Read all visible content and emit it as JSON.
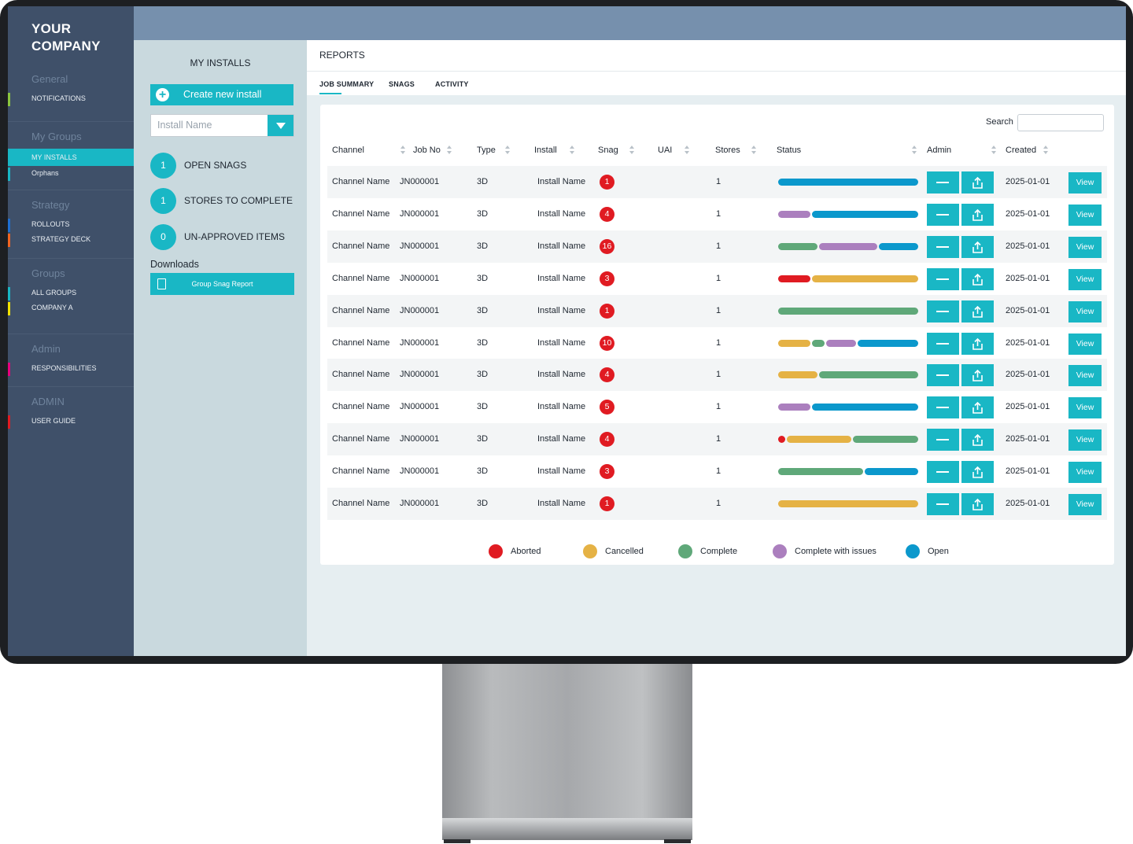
{
  "brand": "YOUR\nCOMPANY",
  "sidebar": {
    "sections": [
      {
        "head": "General",
        "items": [
          {
            "label": "NOTIFICATIONS",
            "color": "#8cc63f"
          }
        ]
      },
      {
        "head": "My Groups",
        "items": [
          {
            "label": "MY INSTALLS",
            "color": "#19b7c5",
            "active": true
          },
          {
            "label": "Orphans",
            "color": "#19b7c5"
          }
        ]
      },
      {
        "head": "Strategy",
        "items": [
          {
            "label": "ROLLOUTS",
            "color": "#1f6fd1"
          },
          {
            "label": "STRATEGY DECK",
            "color": "#f26522"
          }
        ]
      },
      {
        "head": "Groups",
        "items": [
          {
            "label": "ALL GROUPS",
            "color": "#19b7c5"
          },
          {
            "label": "COMPANY A",
            "color": "#f2e200"
          }
        ]
      },
      {
        "head": "Admin",
        "items": [
          {
            "label": "RESPONSIBILITIES",
            "color": "#e6007e"
          }
        ]
      },
      {
        "head": "ADMIN",
        "items": [
          {
            "label": "USER GUIDE",
            "color": "#e01b22"
          }
        ]
      }
    ]
  },
  "panel": {
    "title": "MY INSTALLS",
    "create_label": "Create new install",
    "install_placeholder": "Install Name",
    "stats": [
      {
        "count": "1",
        "label": "OPEN SNAGS"
      },
      {
        "count": "1",
        "label": "STORES TO COMPLETE"
      },
      {
        "count": "0",
        "label": "UN-APPROVED ITEMS"
      }
    ],
    "downloads_label": "Downloads",
    "download_button": "Group Snag Report"
  },
  "main": {
    "title": "REPORTS",
    "tabs": [
      "JOB SUMMARY",
      "SNAGS",
      "ACTIVITY"
    ],
    "search_label": "Search"
  },
  "table": {
    "columns": [
      "Channel",
      "Job No",
      "Type",
      "Install",
      "Snag",
      "UAI",
      "Stores",
      "Status",
      "Admin",
      "Created"
    ],
    "view_label": "View",
    "rows": [
      {
        "channel": "Channel Name",
        "job": "JN000001",
        "type": "3D",
        "install": "Install Name",
        "snag": "1",
        "uai": "",
        "stores": "1",
        "created": "2025-01-01",
        "status": [
          [
            "open",
            1
          ]
        ]
      },
      {
        "channel": "Channel Name",
        "job": "JN000001",
        "type": "3D",
        "install": "Install Name",
        "snag": "4",
        "uai": "",
        "stores": "1",
        "created": "2025-01-01",
        "status": [
          [
            "issues",
            0.24
          ],
          [
            "open",
            0.76
          ]
        ]
      },
      {
        "channel": "Channel Name",
        "job": "JN000001",
        "type": "3D",
        "install": "Install Name",
        "snag": "16",
        "uai": "",
        "stores": "1",
        "created": "2025-01-01",
        "status": [
          [
            "complete",
            0.29
          ],
          [
            "issues",
            0.43
          ],
          [
            "open",
            0.28
          ]
        ]
      },
      {
        "channel": "Channel Name",
        "job": "JN000001",
        "type": "3D",
        "install": "Install Name",
        "snag": "3",
        "uai": "",
        "stores": "1",
        "created": "2025-01-01",
        "status": [
          [
            "aborted",
            0.24
          ],
          [
            "cancelled",
            0.76
          ]
        ]
      },
      {
        "channel": "Channel Name",
        "job": "JN000001",
        "type": "3D",
        "install": "Install Name",
        "snag": "1",
        "uai": "",
        "stores": "1",
        "created": "2025-01-01",
        "status": [
          [
            "complete",
            1
          ]
        ]
      },
      {
        "channel": "Channel Name",
        "job": "JN000001",
        "type": "3D",
        "install": "Install Name",
        "snag": "10",
        "uai": "",
        "stores": "1",
        "created": "2025-01-01",
        "status": [
          [
            "cancelled",
            0.24
          ],
          [
            "complete",
            0.1
          ],
          [
            "issues",
            0.23
          ],
          [
            "open",
            0.43
          ]
        ]
      },
      {
        "channel": "Channel Name",
        "job": "JN000001",
        "type": "3D",
        "install": "Install Name",
        "snag": "4",
        "uai": "",
        "stores": "1",
        "created": "2025-01-01",
        "status": [
          [
            "cancelled",
            0.29
          ],
          [
            "complete",
            0.71
          ]
        ]
      },
      {
        "channel": "Channel Name",
        "job": "JN000001",
        "type": "3D",
        "install": "Install Name",
        "snag": "5",
        "uai": "",
        "stores": "1",
        "created": "2025-01-01",
        "status": [
          [
            "issues",
            0.24
          ],
          [
            "open",
            0.76
          ]
        ]
      },
      {
        "channel": "Channel Name",
        "job": "JN000001",
        "type": "3D",
        "install": "Install Name",
        "snag": "4",
        "uai": "",
        "stores": "1",
        "created": "2025-01-01",
        "status": [
          [
            "aborted",
            0.06
          ],
          [
            "cancelled",
            0.47
          ],
          [
            "complete",
            0.47
          ]
        ]
      },
      {
        "channel": "Channel Name",
        "job": "JN000001",
        "type": "3D",
        "install": "Install Name",
        "snag": "3",
        "uai": "",
        "stores": "1",
        "created": "2025-01-01",
        "status": [
          [
            "complete",
            0.62
          ],
          [
            "open",
            0.38
          ]
        ]
      },
      {
        "channel": "Channel Name",
        "job": "JN000001",
        "type": "3D",
        "install": "Install Name",
        "snag": "1",
        "uai": "",
        "stores": "1",
        "created": "2025-01-01",
        "status": [
          [
            "cancelled",
            1
          ]
        ]
      }
    ]
  },
  "legend": [
    {
      "key": "aborted",
      "label": "Aborted",
      "color": "#e01b22"
    },
    {
      "key": "cancelled",
      "label": "Cancelled",
      "color": "#e5b245"
    },
    {
      "key": "complete",
      "label": "Complete",
      "color": "#5fa879"
    },
    {
      "key": "issues",
      "label": "Complete with issues",
      "color": "#ab7fbe"
    },
    {
      "key": "open",
      "label": "Open",
      "color": "#0b98cc"
    }
  ]
}
